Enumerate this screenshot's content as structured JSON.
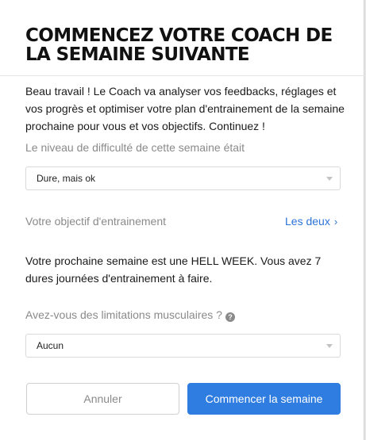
{
  "modal": {
    "title": "COMMENCEZ VOTRE COACH DE LA SEMAINE SUIVANTE",
    "intro": "Beau travail ! Le Coach va analyser vos feedbacks, réglages et vos progrès et optimiser votre plan d'entrainement de la semaine prochaine pour vous et vos objectifs. Continuez !"
  },
  "difficulty": {
    "label": "Le niveau de difficulté de cette semaine était",
    "selected": "Dure, mais ok"
  },
  "objective": {
    "label": "Votre objectif d'entrainement",
    "link_text": "Les deux",
    "chevron": "›"
  },
  "week_info": {
    "text": "Votre prochaine semaine est une HELL WEEK. Vous avez 7 dures journées d'entrainement à faire."
  },
  "limitations": {
    "label": "Avez-vous des limitations musculaires ?",
    "help_glyph": "?",
    "selected": "Aucun"
  },
  "buttons": {
    "cancel": "Annuler",
    "start": "Commencer la semaine"
  }
}
